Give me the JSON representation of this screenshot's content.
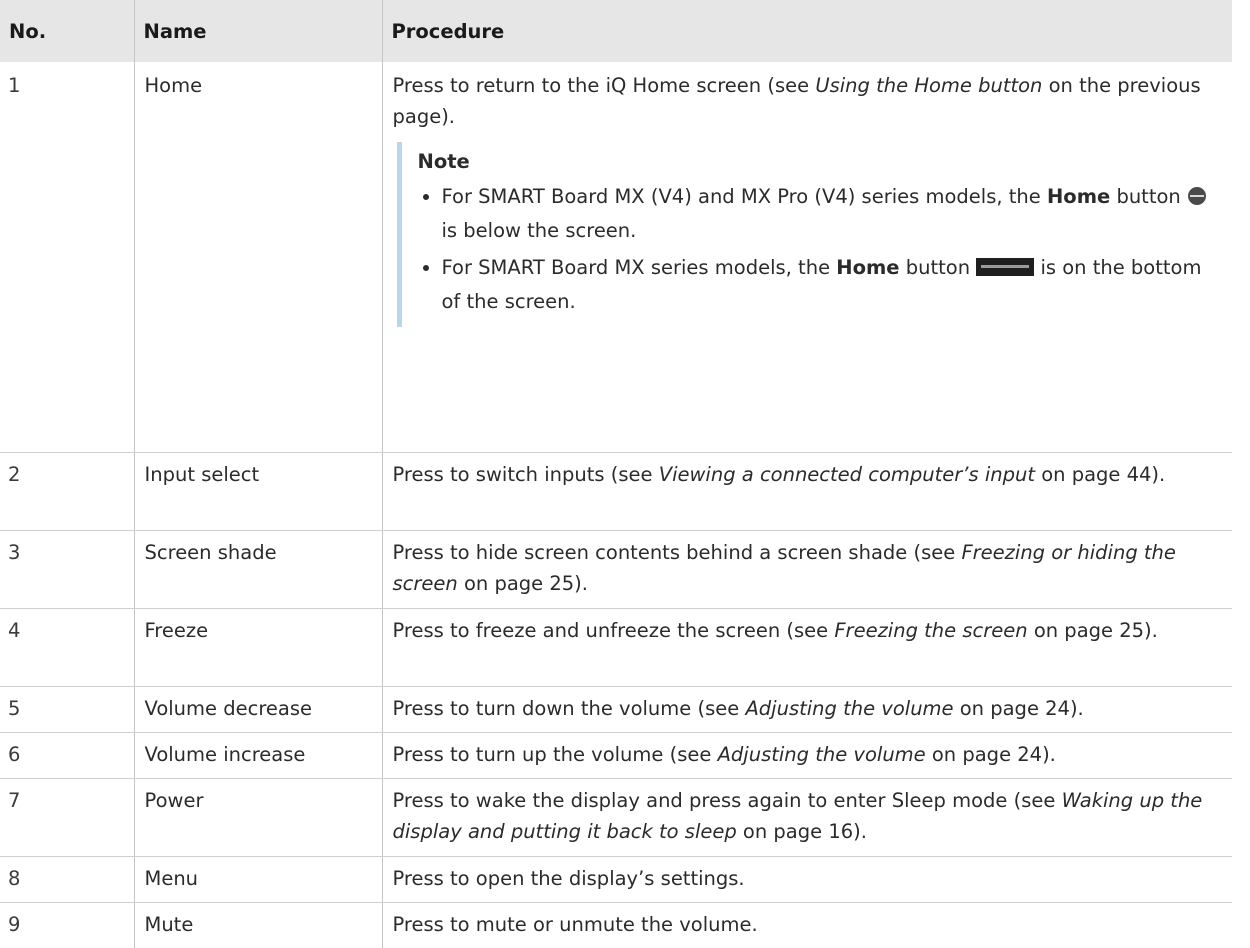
{
  "headers": [
    "No.",
    "Name",
    "Procedure"
  ],
  "rows": [
    {
      "no": "1",
      "name": "Home",
      "proc_before": "Press to return to the iQ Home screen (see ",
      "proc_link": "Using the Home button",
      "proc_after": " on the previous page).",
      "note": {
        "title": "Note",
        "item1": {
          "text_a": "For SMART Board MX (V4) and MX Pro (V4) series models, the ",
          "bold": "Home",
          "text_b": " button ",
          "icon": "round-home-button-icon",
          "text_c": " is below the screen."
        },
        "item2": {
          "text_a": "For SMART Board MX series models, the ",
          "bold": "Home",
          "text_b": " button ",
          "icon": "bar-home-button-icon",
          "text_c": " is on the bottom of the screen."
        }
      }
    },
    {
      "no": "2",
      "name": "Input select",
      "proc_before": "Press to switch inputs (see ",
      "proc_link": "Viewing a connected computer’s input",
      "proc_after": " on page 44)."
    },
    {
      "no": "3",
      "name": "Screen shade",
      "proc_before": "Press to hide screen contents behind a screen shade (see ",
      "proc_link": "Freezing or hiding the screen",
      "proc_after": " on page 25)."
    },
    {
      "no": "4",
      "name": "Freeze",
      "proc_before": "Press to freeze and unfreeze the screen (see ",
      "proc_link": "Freezing the screen",
      "proc_after": " on page 25)."
    },
    {
      "no": "5",
      "name": "Volume decrease",
      "proc_before": "Press to turn down the volume (see ",
      "proc_link": "Adjusting the volume",
      "proc_after": " on page 24)."
    },
    {
      "no": "6",
      "name": "Volume increase",
      "proc_before": "Press to turn up the volume (see ",
      "proc_link": "Adjusting the volume",
      "proc_after": " on page 24)."
    },
    {
      "no": "7",
      "name": "Power",
      "proc_before": "Press to wake the display and press again to enter Sleep mode (see ",
      "proc_link": "Waking up the display and putting it back to sleep",
      "proc_after": " on page 16)."
    },
    {
      "no": "8",
      "name": "Menu",
      "proc_before": "Press to open the display’s settings.",
      "proc_link": "",
      "proc_after": ""
    },
    {
      "no": "9",
      "name": "Mute",
      "proc_before": "Press to mute or unmute the volume.",
      "proc_link": "",
      "proc_after": ""
    }
  ],
  "colors": {
    "header_bg": "#e6e6e6",
    "note_bar": "#b5d8ea",
    "text": "#2b2b2b"
  }
}
